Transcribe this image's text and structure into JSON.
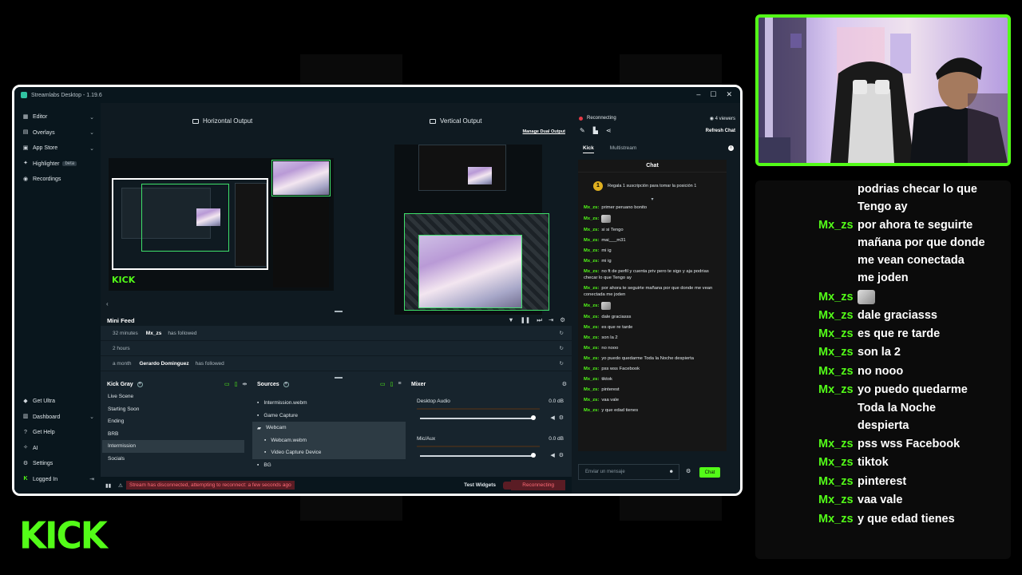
{
  "colors": {
    "accent": "#53fc18",
    "error": "#ff6b77",
    "panel": "#17242d"
  },
  "window": {
    "title": "Streamlabs Desktop - 1.19.6"
  },
  "sidebar": {
    "items": [
      {
        "label": "Editor",
        "icon": "editor-icon",
        "chevron": true
      },
      {
        "label": "Overlays",
        "icon": "overlays-icon",
        "chevron": true
      },
      {
        "label": "App Store",
        "icon": "app-store-icon",
        "chevron": true
      },
      {
        "label": "Highlighter",
        "icon": "highlighter-icon",
        "badge": "beta"
      },
      {
        "label": "Recordings",
        "icon": "recordings-icon"
      }
    ],
    "bottom": [
      {
        "label": "Get Ultra",
        "icon": "ultra-icon"
      },
      {
        "label": "Dashboard",
        "icon": "dashboard-icon",
        "chevron": true
      },
      {
        "label": "Get Help",
        "icon": "help-icon"
      },
      {
        "label": "AI",
        "icon": "ai-icon"
      },
      {
        "label": "Settings",
        "icon": "settings-icon"
      },
      {
        "label": "Logged In",
        "icon": "kick-icon"
      }
    ]
  },
  "editor": {
    "horizontal_label": "Horizontal Output",
    "vertical_label": "Vertical Output",
    "manage_dual": "Manage Dual Output",
    "kick_text": "KICK"
  },
  "minifeed": {
    "title": "Mini Feed",
    "rows": [
      {
        "time": "32 minutes",
        "user": "Mx_zs",
        "action": "has followed"
      },
      {
        "time": "2 hours",
        "user": "",
        "action": ""
      },
      {
        "time": "a month",
        "user": "Gerardo Dominguez",
        "action": "has followed"
      }
    ]
  },
  "scenes": {
    "title": "Kick Gray",
    "items": [
      "Live Scene",
      "Starting Soon",
      "Ending",
      "BRB",
      "Intermission",
      "Socials"
    ],
    "active": 4
  },
  "sources": {
    "title": "Sources",
    "items": [
      {
        "label": "Intermission.webm",
        "child": false,
        "hl": false
      },
      {
        "label": "Game Capture",
        "child": false,
        "hl": false
      },
      {
        "label": "Webcam",
        "child": false,
        "hl": true
      },
      {
        "label": "Webcam.webm",
        "child": true,
        "hl": true
      },
      {
        "label": "Video Capture Device",
        "child": true,
        "hl": true
      },
      {
        "label": "BG",
        "child": false,
        "hl": false
      }
    ]
  },
  "mixer": {
    "title": "Mixer",
    "channels": [
      {
        "name": "Desktop Audio",
        "db": "0.0 dB",
        "level": 1.0
      },
      {
        "name": "Mic/Aux",
        "db": "0.0 dB",
        "level": 1.0
      }
    ]
  },
  "footer": {
    "error": "Stream has disconnected, attempting to reconnect: a few seconds ago",
    "test_widgets": "Test Widgets",
    "reconnecting": "Reconnecting"
  },
  "chat_panel": {
    "status": "Reconnecting",
    "viewers": "4 viewers",
    "refresh": "Refresh Chat",
    "tabs": [
      "Kick",
      "Multistream"
    ],
    "header": "Chat",
    "promo": "Regala 1 suscripción para tomar la posición 1",
    "promo_number": "1",
    "messages": [
      {
        "user": "Mx_zs:",
        "text": "primer peruano bonito"
      },
      {
        "user": "Mx_zs:",
        "text": "",
        "emote": "emote-icon"
      },
      {
        "user": "Mx_zs:",
        "text": "si si Tengo"
      },
      {
        "user": "Mx_zs:",
        "text": "mai___m31"
      },
      {
        "user": "Mx_zs:",
        "text": "mi ig"
      },
      {
        "user": "Mx_zs:",
        "text": "mi ig"
      },
      {
        "user": "Mx_zs:",
        "text": "no ft de perfil y cuenta priv pero te sigo y aja podrias checar lo que Tengo ay"
      },
      {
        "user": "Mx_zs:",
        "text": "por ahora te seguirte mañana por que donde me vean conectada me joden"
      },
      {
        "user": "Mx_zs:",
        "text": "",
        "emote": "emote-icon"
      },
      {
        "user": "Mx_zs:",
        "text": "dale graciasss"
      },
      {
        "user": "Mx_zs:",
        "text": "es que re tarde"
      },
      {
        "user": "Mx_zs:",
        "text": "son la 2"
      },
      {
        "user": "Mx_zs:",
        "text": "no nooo"
      },
      {
        "user": "Mx_zs:",
        "text": "yo puedo quedarme Toda la Noche despierta"
      },
      {
        "user": "Mx_zs:",
        "text": "pss wss Facebook"
      },
      {
        "user": "Mx_zs:",
        "text": "tiktok"
      },
      {
        "user": "Mx_zs:",
        "text": "pinterest"
      },
      {
        "user": "Mx_zs:",
        "text": "vaa vale"
      },
      {
        "user": "Mx_zs:",
        "text": "y que edad tienes"
      }
    ],
    "input_placeholder": "Enviar un mensaje",
    "send": "Chat"
  },
  "overlay_chat": {
    "rows": [
      {
        "user": "",
        "text": "podrias checar lo que"
      },
      {
        "user": "",
        "text": "Tengo ay"
      },
      {
        "user": "Mx_zs",
        "text": "por ahora te seguirte"
      },
      {
        "user": "",
        "text": "mañana por que donde"
      },
      {
        "user": "",
        "text": "me vean conectada"
      },
      {
        "user": "",
        "text": "me joden"
      },
      {
        "user": "Mx_zs",
        "text": "",
        "emote": true
      },
      {
        "user": "Mx_zs",
        "text": "dale graciasss"
      },
      {
        "user": "Mx_zs",
        "text": "es que re tarde"
      },
      {
        "user": "Mx_zs",
        "text": "son la 2"
      },
      {
        "user": "Mx_zs",
        "text": "no nooo"
      },
      {
        "user": "Mx_zs",
        "text": "yo puedo quedarme"
      },
      {
        "user": "",
        "text": "Toda la Noche"
      },
      {
        "user": "",
        "text": "despierta"
      },
      {
        "user": "Mx_zs",
        "text": "pss wss Facebook"
      },
      {
        "user": "Mx_zs",
        "text": "tiktok"
      },
      {
        "user": "Mx_zs",
        "text": "pinterest"
      },
      {
        "user": "Mx_zs",
        "text": "vaa vale"
      },
      {
        "user": "Mx_zs",
        "text": "y que edad tienes"
      }
    ]
  },
  "brand": {
    "logo_text": "KICK"
  }
}
